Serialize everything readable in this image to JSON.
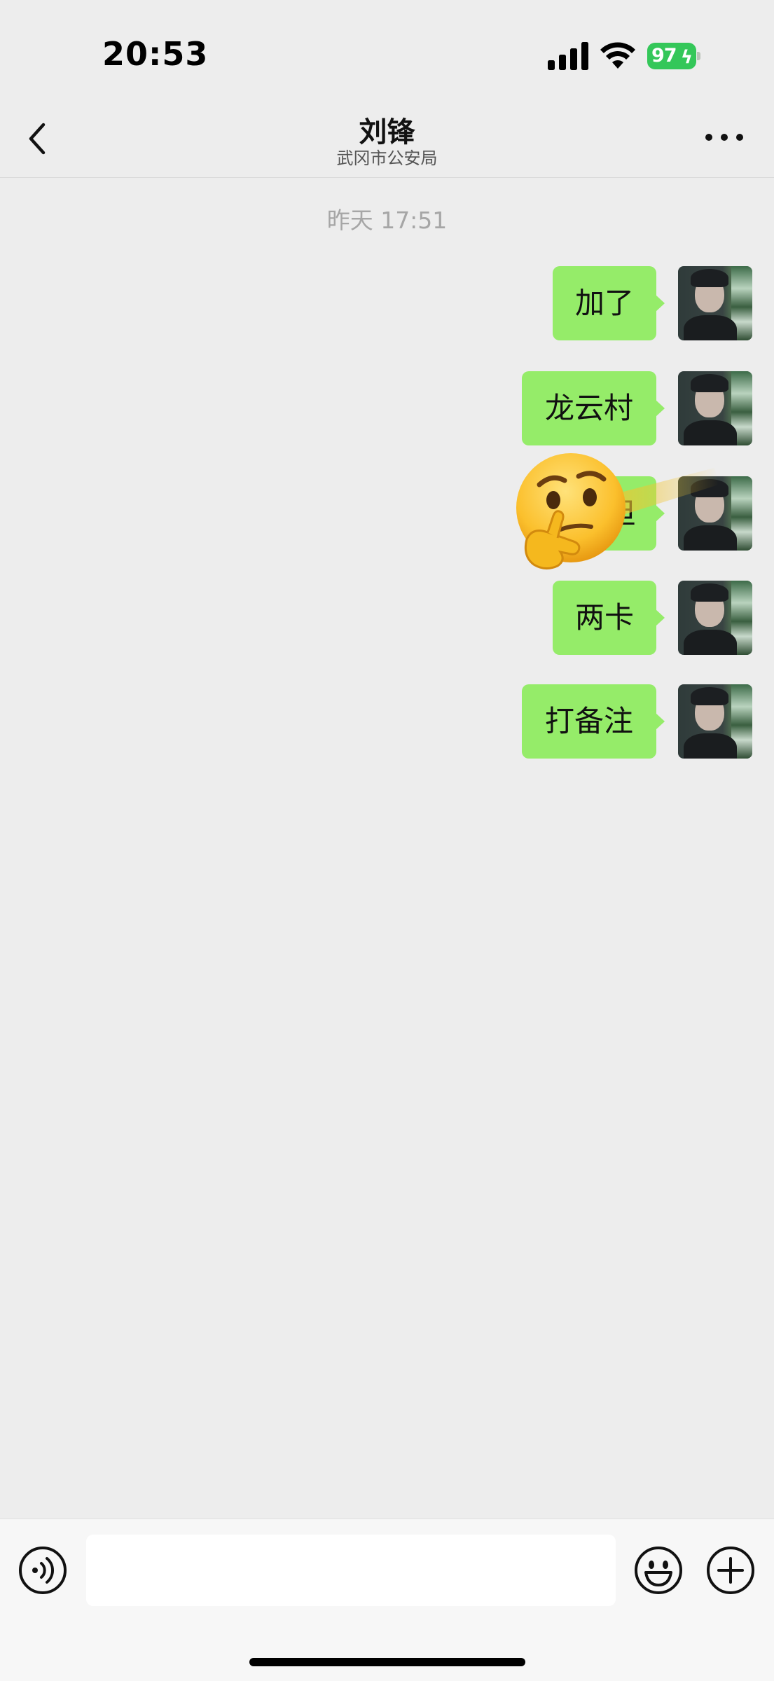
{
  "status_bar": {
    "time": "20:53",
    "battery": "97",
    "icons": [
      "signal-icon",
      "wifi-icon",
      "battery-icon",
      "charging-bolt-icon"
    ]
  },
  "header": {
    "title": "刘锋",
    "subtitle": "武冈市公安局",
    "back_icon": "chevron-left-icon",
    "more_icon": "more-dots-icon"
  },
  "chat": {
    "timestamp": "昨天 17:51",
    "messages": [
      {
        "text": "加了",
        "sender": "self"
      },
      {
        "text": "龙云村",
        "sender": "self"
      },
      {
        "text": "但",
        "sender": "self"
      },
      {
        "text": "两卡",
        "sender": "self"
      },
      {
        "text": "打备注",
        "sender": "self"
      }
    ],
    "sticker": "thinking-face-icon"
  },
  "input_bar": {
    "message_value": "",
    "message_placeholder": "",
    "voice_icon": "voice-icon",
    "emoji_icon": "emoji-icon",
    "plus_icon": "plus-icon"
  },
  "colors": {
    "background": "#ededed",
    "bubble_self": "#95ec69",
    "battery": "#34c759",
    "input_bar": "#f7f7f7"
  }
}
